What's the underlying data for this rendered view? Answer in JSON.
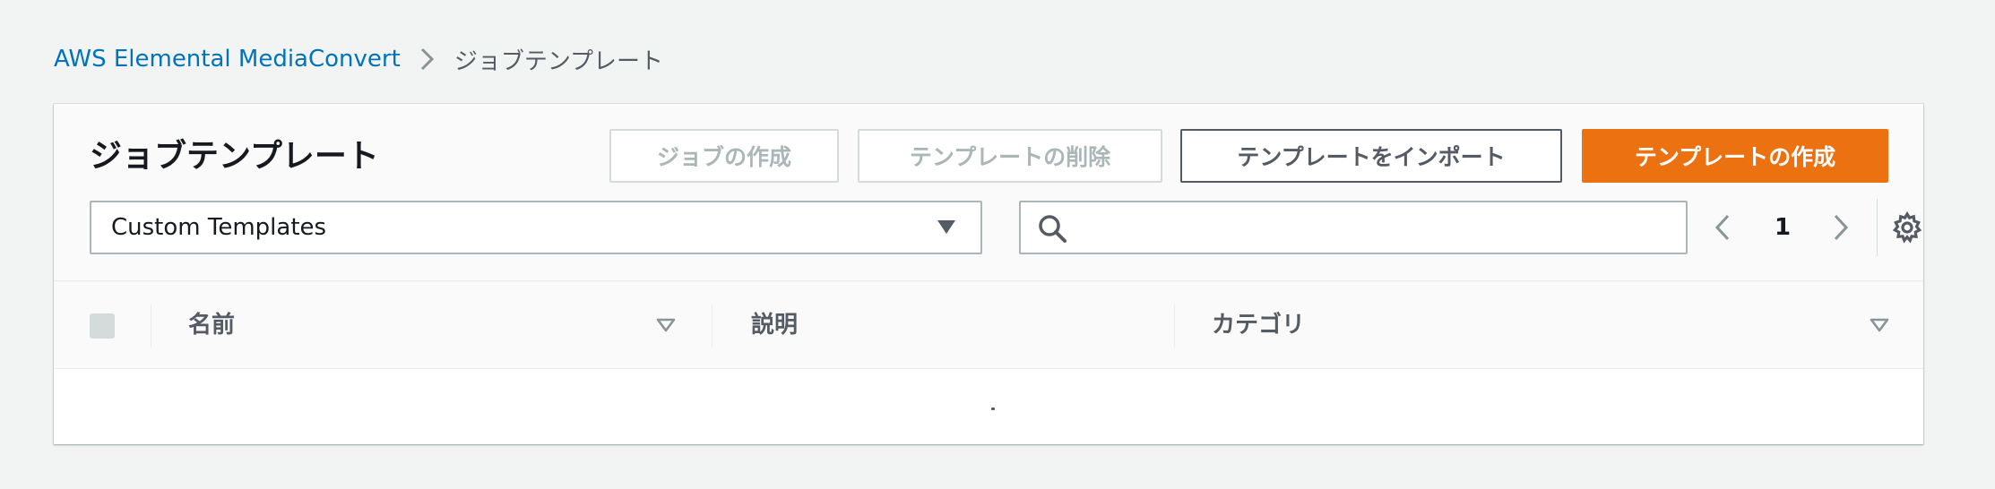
{
  "breadcrumb": {
    "service": "AWS Elemental MediaConvert",
    "current": "ジョブテンプレート"
  },
  "panel": {
    "title": "ジョブテンプレート",
    "buttons": {
      "create_job": "ジョブの作成",
      "delete_template": "テンプレートの削除",
      "import_template": "テンプレートをインポート",
      "create_template": "テンプレートの作成"
    },
    "filter_select": {
      "value": "Custom Templates"
    },
    "search": {
      "value": "",
      "placeholder": ""
    },
    "pagination": {
      "current_page": "1"
    }
  },
  "table": {
    "columns": [
      "名前",
      "説明",
      "カテゴリ"
    ],
    "rows": []
  },
  "colors": {
    "primary": "#ec7211",
    "link": "#0073bb",
    "background": "#f2f3f3"
  },
  "icons": [
    "chevron-right-icon",
    "caret-down-icon",
    "search-icon",
    "chevron-left-icon",
    "gear-icon",
    "sort-down-icon"
  ]
}
